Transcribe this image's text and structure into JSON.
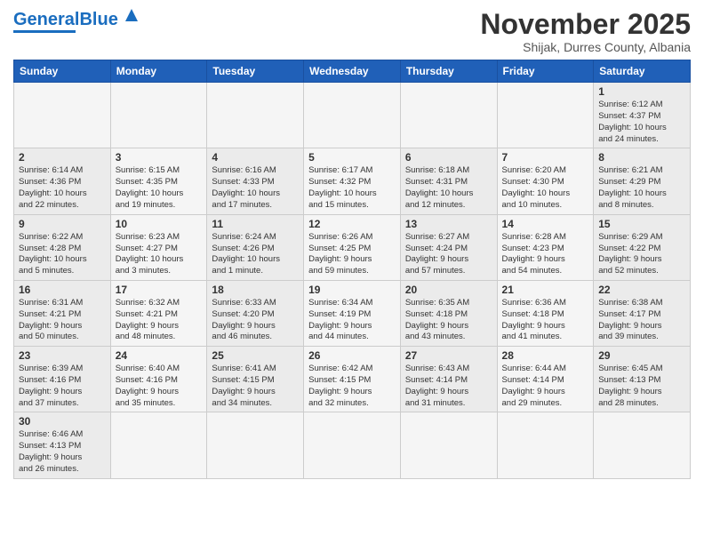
{
  "header": {
    "logo_general": "General",
    "logo_blue": "Blue",
    "month_title": "November 2025",
    "subtitle": "Shijak, Durres County, Albania"
  },
  "weekdays": [
    "Sunday",
    "Monday",
    "Tuesday",
    "Wednesday",
    "Thursday",
    "Friday",
    "Saturday"
  ],
  "weeks": [
    [
      {
        "day": "",
        "info": ""
      },
      {
        "day": "",
        "info": ""
      },
      {
        "day": "",
        "info": ""
      },
      {
        "day": "",
        "info": ""
      },
      {
        "day": "",
        "info": ""
      },
      {
        "day": "",
        "info": ""
      },
      {
        "day": "1",
        "info": "Sunrise: 6:12 AM\nSunset: 4:37 PM\nDaylight: 10 hours\nand 24 minutes."
      }
    ],
    [
      {
        "day": "2",
        "info": "Sunrise: 6:14 AM\nSunset: 4:36 PM\nDaylight: 10 hours\nand 22 minutes."
      },
      {
        "day": "3",
        "info": "Sunrise: 6:15 AM\nSunset: 4:35 PM\nDaylight: 10 hours\nand 19 minutes."
      },
      {
        "day": "4",
        "info": "Sunrise: 6:16 AM\nSunset: 4:33 PM\nDaylight: 10 hours\nand 17 minutes."
      },
      {
        "day": "5",
        "info": "Sunrise: 6:17 AM\nSunset: 4:32 PM\nDaylight: 10 hours\nand 15 minutes."
      },
      {
        "day": "6",
        "info": "Sunrise: 6:18 AM\nSunset: 4:31 PM\nDaylight: 10 hours\nand 12 minutes."
      },
      {
        "day": "7",
        "info": "Sunrise: 6:20 AM\nSunset: 4:30 PM\nDaylight: 10 hours\nand 10 minutes."
      },
      {
        "day": "8",
        "info": "Sunrise: 6:21 AM\nSunset: 4:29 PM\nDaylight: 10 hours\nand 8 minutes."
      }
    ],
    [
      {
        "day": "9",
        "info": "Sunrise: 6:22 AM\nSunset: 4:28 PM\nDaylight: 10 hours\nand 5 minutes."
      },
      {
        "day": "10",
        "info": "Sunrise: 6:23 AM\nSunset: 4:27 PM\nDaylight: 10 hours\nand 3 minutes."
      },
      {
        "day": "11",
        "info": "Sunrise: 6:24 AM\nSunset: 4:26 PM\nDaylight: 10 hours\nand 1 minute."
      },
      {
        "day": "12",
        "info": "Sunrise: 6:26 AM\nSunset: 4:25 PM\nDaylight: 9 hours\nand 59 minutes."
      },
      {
        "day": "13",
        "info": "Sunrise: 6:27 AM\nSunset: 4:24 PM\nDaylight: 9 hours\nand 57 minutes."
      },
      {
        "day": "14",
        "info": "Sunrise: 6:28 AM\nSunset: 4:23 PM\nDaylight: 9 hours\nand 54 minutes."
      },
      {
        "day": "15",
        "info": "Sunrise: 6:29 AM\nSunset: 4:22 PM\nDaylight: 9 hours\nand 52 minutes."
      }
    ],
    [
      {
        "day": "16",
        "info": "Sunrise: 6:31 AM\nSunset: 4:21 PM\nDaylight: 9 hours\nand 50 minutes."
      },
      {
        "day": "17",
        "info": "Sunrise: 6:32 AM\nSunset: 4:21 PM\nDaylight: 9 hours\nand 48 minutes."
      },
      {
        "day": "18",
        "info": "Sunrise: 6:33 AM\nSunset: 4:20 PM\nDaylight: 9 hours\nand 46 minutes."
      },
      {
        "day": "19",
        "info": "Sunrise: 6:34 AM\nSunset: 4:19 PM\nDaylight: 9 hours\nand 44 minutes."
      },
      {
        "day": "20",
        "info": "Sunrise: 6:35 AM\nSunset: 4:18 PM\nDaylight: 9 hours\nand 43 minutes."
      },
      {
        "day": "21",
        "info": "Sunrise: 6:36 AM\nSunset: 4:18 PM\nDaylight: 9 hours\nand 41 minutes."
      },
      {
        "day": "22",
        "info": "Sunrise: 6:38 AM\nSunset: 4:17 PM\nDaylight: 9 hours\nand 39 minutes."
      }
    ],
    [
      {
        "day": "23",
        "info": "Sunrise: 6:39 AM\nSunset: 4:16 PM\nDaylight: 9 hours\nand 37 minutes."
      },
      {
        "day": "24",
        "info": "Sunrise: 6:40 AM\nSunset: 4:16 PM\nDaylight: 9 hours\nand 35 minutes."
      },
      {
        "day": "25",
        "info": "Sunrise: 6:41 AM\nSunset: 4:15 PM\nDaylight: 9 hours\nand 34 minutes."
      },
      {
        "day": "26",
        "info": "Sunrise: 6:42 AM\nSunset: 4:15 PM\nDaylight: 9 hours\nand 32 minutes."
      },
      {
        "day": "27",
        "info": "Sunrise: 6:43 AM\nSunset: 4:14 PM\nDaylight: 9 hours\nand 31 minutes."
      },
      {
        "day": "28",
        "info": "Sunrise: 6:44 AM\nSunset: 4:14 PM\nDaylight: 9 hours\nand 29 minutes."
      },
      {
        "day": "29",
        "info": "Sunrise: 6:45 AM\nSunset: 4:13 PM\nDaylight: 9 hours\nand 28 minutes."
      }
    ],
    [
      {
        "day": "30",
        "info": "Sunrise: 6:46 AM\nSunset: 4:13 PM\nDaylight: 9 hours\nand 26 minutes."
      },
      {
        "day": "",
        "info": ""
      },
      {
        "day": "",
        "info": ""
      },
      {
        "day": "",
        "info": ""
      },
      {
        "day": "",
        "info": ""
      },
      {
        "day": "",
        "info": ""
      },
      {
        "day": "",
        "info": ""
      }
    ]
  ]
}
